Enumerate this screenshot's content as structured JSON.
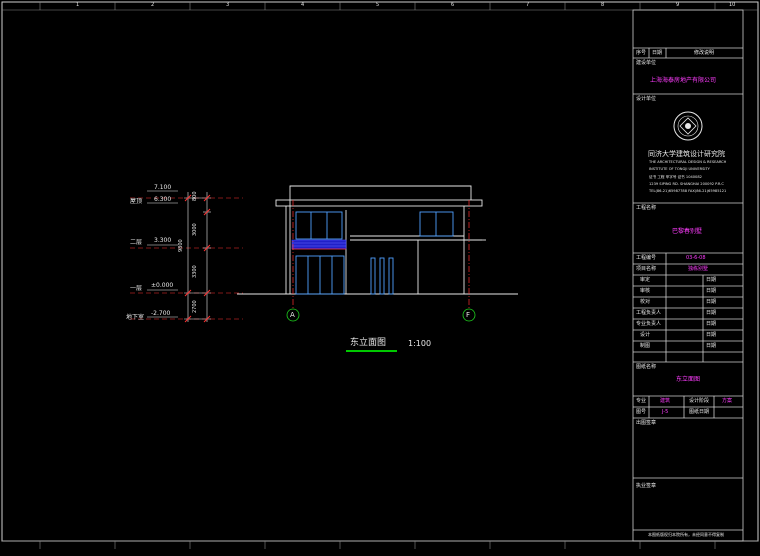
{
  "drawing": {
    "title": "东立面图",
    "scale": "1:100",
    "axes": [
      "A",
      "F"
    ],
    "levels": [
      {
        "label": "屋顶",
        "value": "7.100",
        "value2": "6.300"
      },
      {
        "label": "二层",
        "value": "3.300"
      },
      {
        "label": "一层",
        "value": "±0.000"
      },
      {
        "label": "地下室",
        "value": "-2.700"
      }
    ],
    "dims": [
      "800",
      "3000",
      "3300",
      "2700"
    ],
    "total_dim": "9800"
  },
  "title_block": {
    "rev_header": [
      "序号",
      "日期",
      "修改说明"
    ],
    "client_label": "建设单位",
    "client": "上海海泰房地产有限公司",
    "designer_label": "设计单位",
    "designer": "同济大学建筑设计研究院",
    "designer_en": [
      "THE ARCHITECTURAL DESIGN & RESEARCH",
      "INSTITUTE OF TONGJI UNIVERSITY",
      "证书  工程 甲字号  证书 1040082",
      "1239 SIPING RD. SHANGHAI 200092 P.R.C",
      "TEL(86-21)65987788  FAX(86-21)65985121"
    ],
    "project_label": "工程名称",
    "project": "巴黎春别墅",
    "project_no_label": "工程编号",
    "project_no": "03-6-08",
    "item_label": "项目名称",
    "item": "独栋别墅",
    "sign_rows": [
      "审定",
      "审核",
      "校对",
      "工程负责人",
      "专业负责人",
      "设计",
      "制图"
    ],
    "date_label": "日期",
    "drawing_label": "图纸名称",
    "drawing_name": "东立面图",
    "spec_label": "专业",
    "spec": "建筑",
    "stage_label": "设计阶段",
    "stage": "方案",
    "no_label": "图号",
    "no": "J-5",
    "date2_label": "图纸日期",
    "remarks_label": "出图签章",
    "approve_label": "执业签章",
    "footer": "本图纸版权归本院所有，未经同意不得复制"
  },
  "ruler": {
    "numbers": [
      "1",
      "2",
      "3",
      "4",
      "5",
      "6",
      "7",
      "8",
      "9",
      "10"
    ]
  },
  "colors": {
    "background": "#000000",
    "line": "#e8e8e8",
    "accent": "#ff3cff",
    "axis": "#ff3030",
    "window": "#4fa0ff",
    "band": "#2a2aff",
    "underline": "#00c800"
  }
}
